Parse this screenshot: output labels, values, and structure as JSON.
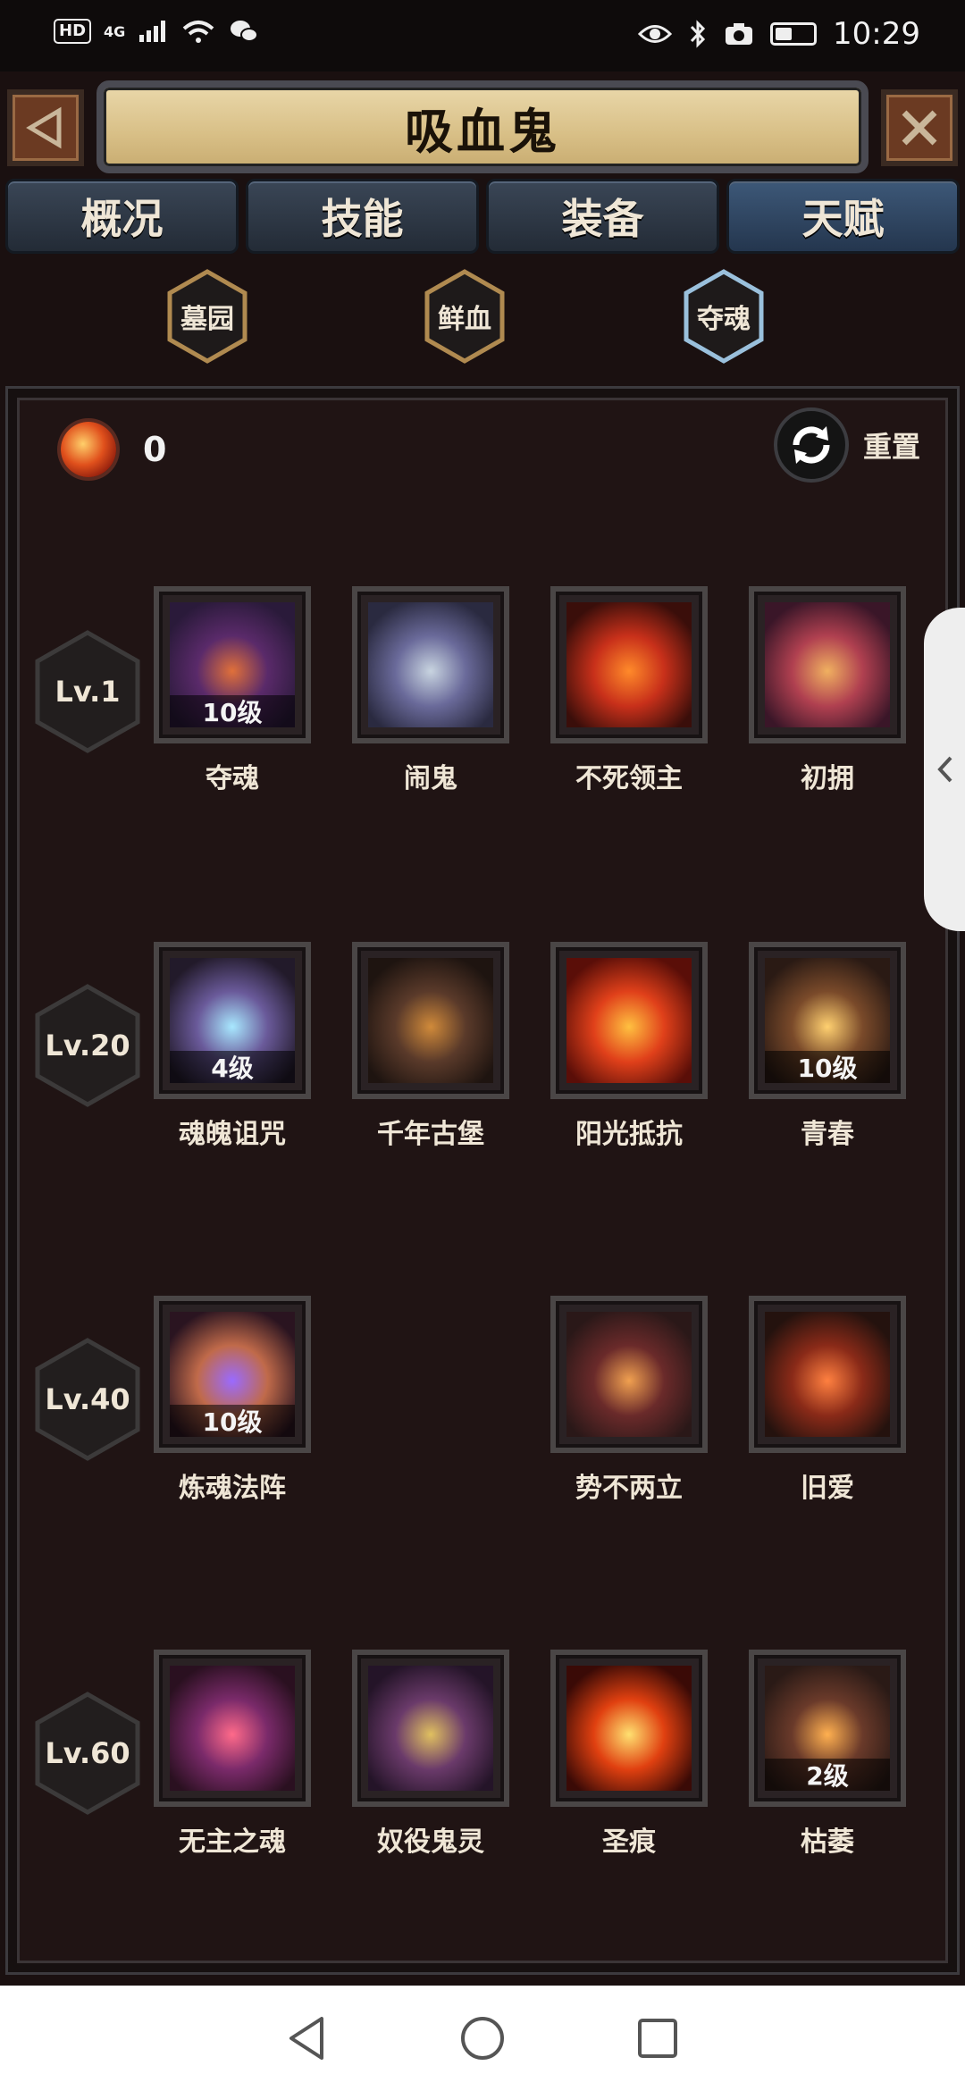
{
  "status_bar": {
    "hd": "HD",
    "network": "4G",
    "time": "10:29",
    "battery_level": "45%"
  },
  "header": {
    "title": "吸血鬼"
  },
  "tabs": [
    {
      "label": "概况",
      "active": false
    },
    {
      "label": "技能",
      "active": false
    },
    {
      "label": "装备",
      "active": false
    },
    {
      "label": "天赋",
      "active": true
    }
  ],
  "subtabs": [
    {
      "label": "墓园",
      "active": false
    },
    {
      "label": "鲜血",
      "active": false
    },
    {
      "label": "夺魂",
      "active": true
    }
  ],
  "currency": {
    "value": "0"
  },
  "reset_label": "重置",
  "rows": [
    {
      "level": "Lv.1",
      "talents": [
        {
          "name": "夺魂",
          "badge": "10级",
          "colors": [
            "#e0703a",
            "#5a2a6a",
            "#2a1a3a"
          ]
        },
        {
          "name": "闹鬼",
          "badge": "",
          "colors": [
            "#c8d4e0",
            "#6a6a9a",
            "#2a2a40"
          ]
        },
        {
          "name": "不死领主",
          "badge": "",
          "colors": [
            "#ff8a2a",
            "#c8301a",
            "#3a0e0a"
          ]
        },
        {
          "name": "初拥",
          "badge": "",
          "colors": [
            "#f0b060",
            "#b04050",
            "#3a1628"
          ]
        }
      ]
    },
    {
      "level": "Lv.20",
      "talents": [
        {
          "name": "魂魄诅咒",
          "badge": "4级",
          "colors": [
            "#a8e8ff",
            "#6a5a9a",
            "#221a2a"
          ]
        },
        {
          "name": "千年古堡",
          "badge": "",
          "colors": [
            "#d08a3a",
            "#5a3a2a",
            "#1e1410"
          ]
        },
        {
          "name": "阳光抵抗",
          "badge": "",
          "colors": [
            "#ffc040",
            "#e0401a",
            "#5a0e08"
          ]
        },
        {
          "name": "青春",
          "badge": "10级",
          "colors": [
            "#ffd070",
            "#7a4a2a",
            "#2a1a14"
          ]
        }
      ]
    },
    {
      "level": "Lv.40",
      "talents": [
        {
          "name": "炼魂法阵",
          "badge": "10级",
          "colors": [
            "#9a6aff",
            "#c06a4a",
            "#2a1420"
          ]
        },
        {
          "name": "",
          "badge": "",
          "colors": [],
          "empty": true
        },
        {
          "name": "势不两立",
          "badge": "",
          "colors": [
            "#f0a050",
            "#6a2a2a",
            "#2a1818"
          ]
        },
        {
          "name": "旧爱",
          "badge": "",
          "colors": [
            "#ff8040",
            "#8a2a18",
            "#24120e"
          ]
        }
      ]
    },
    {
      "level": "Lv.60",
      "talents": [
        {
          "name": "无主之魂",
          "badge": "",
          "colors": [
            "#ff6a8a",
            "#7a2a6a",
            "#2a1020"
          ]
        },
        {
          "name": "奴役鬼灵",
          "badge": "",
          "colors": [
            "#e0c060",
            "#6a3a6a",
            "#241428"
          ]
        },
        {
          "name": "圣痕",
          "badge": "",
          "colors": [
            "#ffe070",
            "#e04010",
            "#3a0a06"
          ]
        },
        {
          "name": "枯萎",
          "badge": "2级",
          "colors": [
            "#ffb050",
            "#6a3a2a",
            "#2a1a16"
          ]
        }
      ]
    }
  ],
  "colors": {
    "accent_gold": "#c8a060",
    "active_hex": "#9ac0dc",
    "panel_bg": "#201414"
  }
}
